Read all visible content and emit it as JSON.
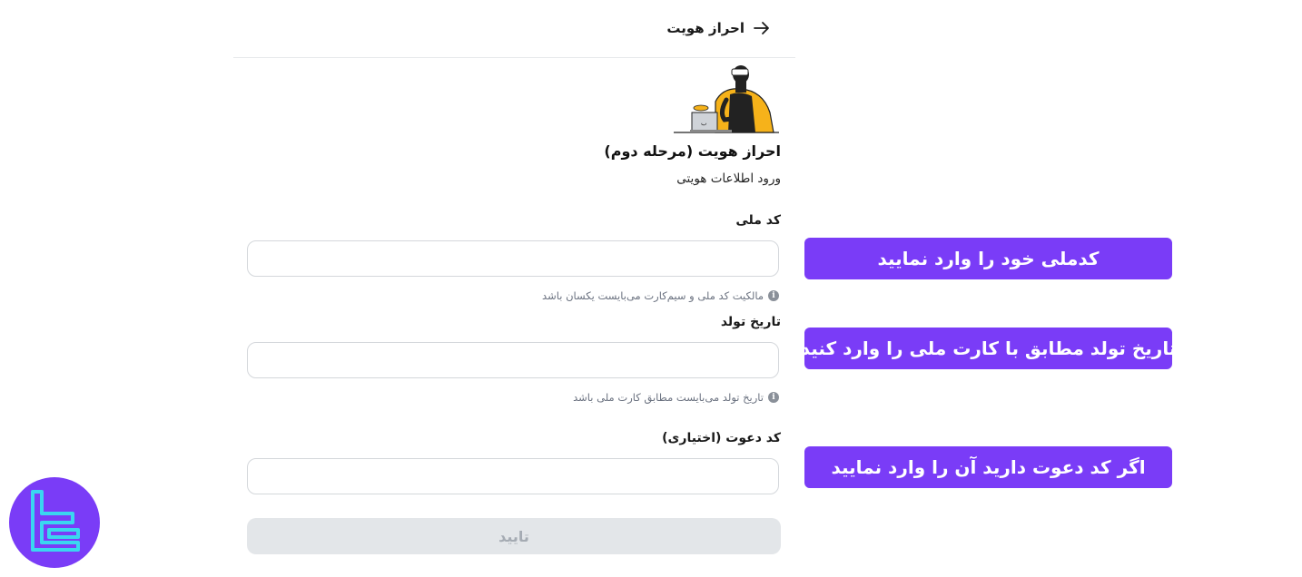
{
  "header": {
    "title": "احراز هویت",
    "back_icon": "arrow-right-icon"
  },
  "step": {
    "title": "احراز هویت (مرحله دوم)",
    "subtitle": "ورود اطلاعات هویتی"
  },
  "form": {
    "national_code": {
      "label": "کد ملی",
      "value": "",
      "hint": "مالکیت کد ملی و سیم‌کارت می‌بایست یکسان باشد"
    },
    "birth_date": {
      "label": "تاریخ تولد",
      "value": "",
      "hint": "تاریخ تولد می‌بایست مطابق کارت ملی باشد"
    },
    "invite_code": {
      "label": "کد دعوت (اختیاری)",
      "value": ""
    },
    "submit_label": "تایید"
  },
  "callouts": [
    "کدملی خود را وارد نمایید",
    "تاریخ تولد مطابق با کارت ملی را وارد کنید",
    "اگر کد دعوت دارید آن را وارد نمایید"
  ],
  "colors": {
    "callout_bg": "#7a3cf7",
    "logo_bg": "#7a3cf7",
    "logo_mark": "#3ad6f0",
    "illustration_accent": "#f6b21a"
  }
}
